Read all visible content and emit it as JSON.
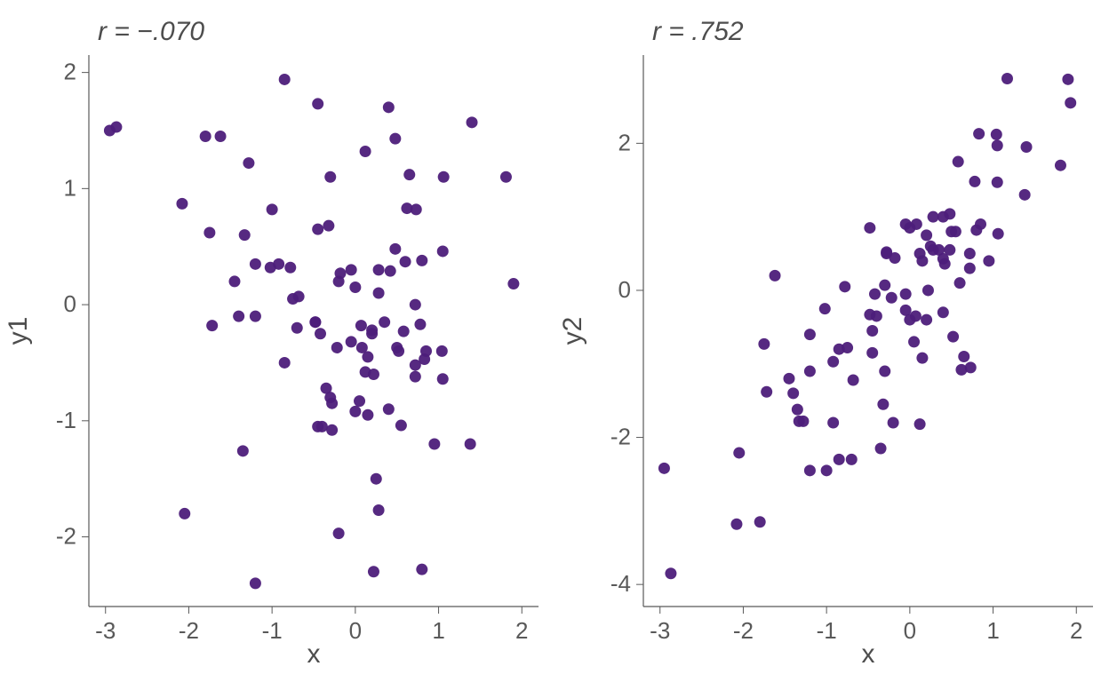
{
  "chart_data": [
    {
      "type": "scatter",
      "title": "r = −.070",
      "xlabel": "x",
      "ylabel": "y1",
      "xlim": [
        -3.2,
        2.2
      ],
      "ylim": [
        -2.6,
        2.15
      ],
      "xticks": [
        -3,
        -2,
        -1,
        0,
        1,
        2
      ],
      "yticks": [
        -2,
        -1,
        0,
        1,
        2
      ],
      "point_color": "#4d1d7a",
      "point_radius": 6.5,
      "series": [
        {
          "name": "y1",
          "points": [
            [
              -2.95,
              1.5
            ],
            [
              -2.87,
              1.53
            ],
            [
              -2.08,
              0.87
            ],
            [
              -2.05,
              -1.8
            ],
            [
              -1.8,
              1.45
            ],
            [
              -1.75,
              0.62
            ],
            [
              -1.72,
              -0.18
            ],
            [
              -1.62,
              1.45
            ],
            [
              -1.45,
              0.2
            ],
            [
              -1.4,
              -0.1
            ],
            [
              -1.35,
              -1.26
            ],
            [
              -1.33,
              0.6
            ],
            [
              -1.28,
              1.22
            ],
            [
              -1.2,
              -0.1
            ],
            [
              -1.2,
              0.35
            ],
            [
              -1.2,
              -2.4
            ],
            [
              -1.02,
              0.32
            ],
            [
              -1.0,
              0.82
            ],
            [
              -0.92,
              0.35
            ],
            [
              -0.85,
              1.94
            ],
            [
              -0.85,
              -0.5
            ],
            [
              -0.78,
              0.32
            ],
            [
              -0.75,
              0.05
            ],
            [
              -0.7,
              -0.2
            ],
            [
              -0.68,
              0.07
            ],
            [
              -0.48,
              -0.15
            ],
            [
              -0.48,
              -0.15
            ],
            [
              -0.45,
              0.65
            ],
            [
              -0.45,
              -1.05
            ],
            [
              -0.45,
              1.73
            ],
            [
              -0.42,
              -0.25
            ],
            [
              -0.4,
              -1.05
            ],
            [
              -0.35,
              -0.72
            ],
            [
              -0.32,
              0.68
            ],
            [
              -0.3,
              -0.8
            ],
            [
              -0.3,
              1.1
            ],
            [
              -0.28,
              -1.08
            ],
            [
              -0.28,
              -0.85
            ],
            [
              -0.22,
              -0.37
            ],
            [
              -0.2,
              0.2
            ],
            [
              -0.18,
              0.27
            ],
            [
              -0.2,
              -1.97
            ],
            [
              -0.05,
              -0.32
            ],
            [
              -0.05,
              0.3
            ],
            [
              0.0,
              0.15
            ],
            [
              0.0,
              -0.92
            ],
            [
              0.05,
              -0.83
            ],
            [
              0.07,
              -0.18
            ],
            [
              0.08,
              -0.37
            ],
            [
              0.12,
              1.32
            ],
            [
              0.12,
              -0.58
            ],
            [
              0.15,
              -0.45
            ],
            [
              0.15,
              -0.95
            ],
            [
              0.2,
              -0.25
            ],
            [
              0.2,
              -0.22
            ],
            [
              0.22,
              -0.6
            ],
            [
              0.22,
              -2.3
            ],
            [
              0.25,
              -1.5
            ],
            [
              0.28,
              0.3
            ],
            [
              0.28,
              -1.77
            ],
            [
              0.28,
              0.1
            ],
            [
              0.35,
              -0.15
            ],
            [
              0.4,
              -0.9
            ],
            [
              0.4,
              1.7
            ],
            [
              0.42,
              0.29
            ],
            [
              0.48,
              0.48
            ],
            [
              0.48,
              1.43
            ],
            [
              0.5,
              -0.37
            ],
            [
              0.52,
              -0.4
            ],
            [
              0.55,
              -1.04
            ],
            [
              0.58,
              -0.23
            ],
            [
              0.6,
              0.37
            ],
            [
              0.62,
              0.83
            ],
            [
              0.65,
              1.12
            ],
            [
              0.72,
              0.0
            ],
            [
              0.72,
              -0.52
            ],
            [
              0.72,
              -0.62
            ],
            [
              0.73,
              0.82
            ],
            [
              0.78,
              -0.17
            ],
            [
              0.8,
              0.38
            ],
            [
              0.8,
              -2.28
            ],
            [
              0.83,
              -0.47
            ],
            [
              0.85,
              -0.4
            ],
            [
              0.95,
              -1.2
            ],
            [
              1.04,
              -0.4
            ],
            [
              1.05,
              -0.64
            ],
            [
              1.05,
              0.46
            ],
            [
              1.06,
              1.1
            ],
            [
              1.38,
              -1.2
            ],
            [
              1.4,
              1.57
            ],
            [
              1.81,
              1.1
            ],
            [
              1.9,
              0.18
            ]
          ]
        }
      ]
    },
    {
      "type": "scatter",
      "title": "r = .752",
      "xlabel": "x",
      "ylabel": "y2",
      "xlim": [
        -3.2,
        2.2
      ],
      "ylim": [
        -4.3,
        3.2
      ],
      "xticks": [
        -3,
        -2,
        -1,
        0,
        1,
        2
      ],
      "yticks": [
        -4,
        -2,
        0,
        2
      ],
      "point_color": "#4d1d7a",
      "point_radius": 6.5,
      "series": [
        {
          "name": "y2",
          "points": [
            [
              -2.95,
              -2.42
            ],
            [
              -2.87,
              -3.85
            ],
            [
              -2.08,
              -3.18
            ],
            [
              -2.05,
              -2.21
            ],
            [
              -1.8,
              -3.15
            ],
            [
              -1.75,
              -0.73
            ],
            [
              -1.72,
              -1.38
            ],
            [
              -1.62,
              0.2
            ],
            [
              -1.45,
              -1.2
            ],
            [
              -1.4,
              -1.4
            ],
            [
              -1.35,
              -1.62
            ],
            [
              -1.33,
              -1.78
            ],
            [
              -1.28,
              -1.78
            ],
            [
              -1.2,
              -0.6
            ],
            [
              -1.2,
              -1.1
            ],
            [
              -1.2,
              -2.45
            ],
            [
              -1.02,
              -0.25
            ],
            [
              -1.0,
              -2.45
            ],
            [
              -0.92,
              -0.97
            ],
            [
              -0.92,
              -1.8
            ],
            [
              -0.85,
              -2.3
            ],
            [
              -0.85,
              -0.8
            ],
            [
              -0.78,
              0.05
            ],
            [
              -0.75,
              -0.78
            ],
            [
              -0.7,
              -2.3
            ],
            [
              -0.68,
              -1.22
            ],
            [
              -0.48,
              -0.33
            ],
            [
              -0.48,
              0.85
            ],
            [
              -0.45,
              -0.55
            ],
            [
              -0.45,
              -0.85
            ],
            [
              -0.42,
              -0.05
            ],
            [
              -0.4,
              -0.35
            ],
            [
              -0.35,
              -2.15
            ],
            [
              -0.32,
              -1.55
            ],
            [
              -0.3,
              0.07
            ],
            [
              -0.3,
              -1.1
            ],
            [
              -0.28,
              0.5
            ],
            [
              -0.28,
              0.52
            ],
            [
              -0.22,
              -0.1
            ],
            [
              -0.2,
              -1.8
            ],
            [
              -0.18,
              0.44
            ],
            [
              -0.05,
              0.9
            ],
            [
              -0.05,
              -0.27
            ],
            [
              -0.05,
              -0.05
            ],
            [
              0.0,
              -0.4
            ],
            [
              0.0,
              0.85
            ],
            [
              0.05,
              -0.7
            ],
            [
              0.07,
              -0.35
            ],
            [
              0.08,
              0.9
            ],
            [
              0.12,
              0.5
            ],
            [
              0.12,
              -1.82
            ],
            [
              0.15,
              0.4
            ],
            [
              0.15,
              -0.92
            ],
            [
              0.2,
              0.75
            ],
            [
              0.2,
              -0.4
            ],
            [
              0.22,
              0.0
            ],
            [
              0.25,
              0.6
            ],
            [
              0.28,
              1.0
            ],
            [
              0.28,
              0.55
            ],
            [
              0.35,
              0.55
            ],
            [
              0.4,
              0.43
            ],
            [
              0.4,
              1.0
            ],
            [
              0.4,
              -0.3
            ],
            [
              0.42,
              0.36
            ],
            [
              0.48,
              1.04
            ],
            [
              0.48,
              0.55
            ],
            [
              0.5,
              0.8
            ],
            [
              0.52,
              -0.63
            ],
            [
              0.55,
              0.8
            ],
            [
              0.58,
              1.75
            ],
            [
              0.6,
              0.1
            ],
            [
              0.62,
              -1.08
            ],
            [
              0.65,
              -0.9
            ],
            [
              0.72,
              0.5
            ],
            [
              0.72,
              0.3
            ],
            [
              0.73,
              -1.05
            ],
            [
              0.78,
              1.48
            ],
            [
              0.8,
              0.82
            ],
            [
              0.83,
              2.13
            ],
            [
              0.85,
              0.9
            ],
            [
              0.95,
              0.4
            ],
            [
              1.04,
              2.12
            ],
            [
              1.05,
              1.47
            ],
            [
              1.05,
              1.97
            ],
            [
              1.06,
              0.77
            ],
            [
              1.17,
              2.88
            ],
            [
              1.38,
              1.3
            ],
            [
              1.4,
              1.95
            ],
            [
              1.81,
              1.7
            ],
            [
              1.9,
              2.87
            ],
            [
              1.93,
              2.55
            ]
          ]
        }
      ]
    }
  ]
}
